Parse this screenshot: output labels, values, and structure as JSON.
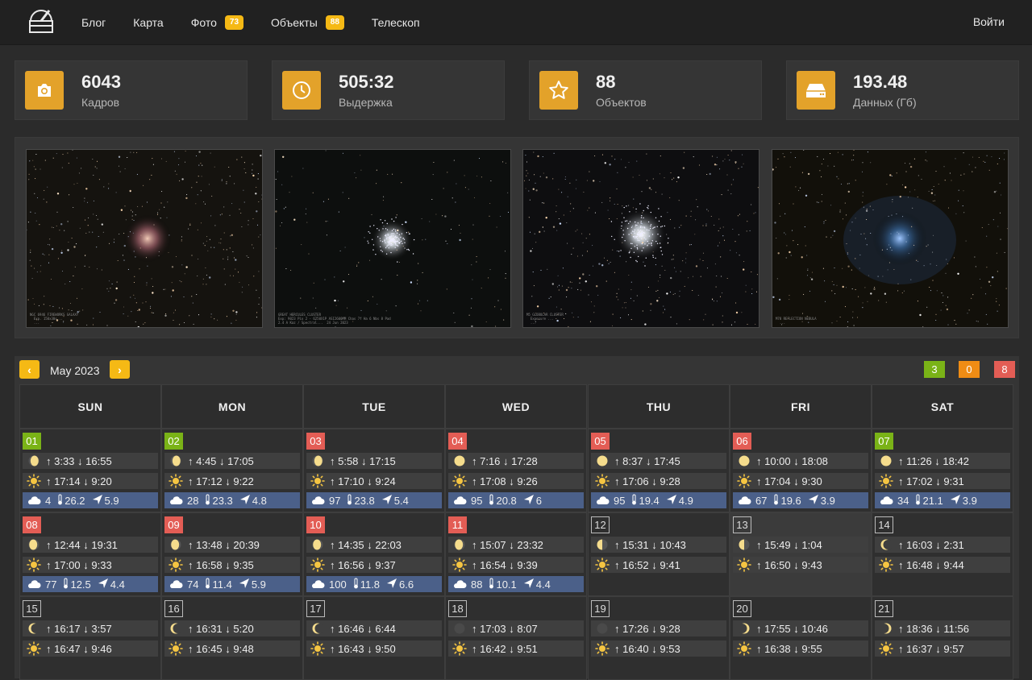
{
  "nav": {
    "links": [
      {
        "label": "Блог"
      },
      {
        "label": "Карта"
      },
      {
        "label": "Фото",
        "badge": "73"
      },
      {
        "label": "Объекты",
        "badge": "88"
      },
      {
        "label": "Телескоп"
      }
    ],
    "login": "Войти"
  },
  "stats": [
    {
      "value": "6043",
      "label": "Кадров",
      "icon": "camera-icon"
    },
    {
      "value": "505:32",
      "label": "Выдержка",
      "icon": "clock-icon"
    },
    {
      "value": "88",
      "label": "Объектов",
      "icon": "star-icon"
    },
    {
      "value": "193.48",
      "label": "Данных (Гб)",
      "icon": "drive-icon"
    }
  ],
  "photos": [
    {
      "name": "photo-galaxy",
      "caption": "NGC 6946 FIREWORKS GALAXY\n  Exp. 150x30s...\n  ...",
      "feature": "galaxy"
    },
    {
      "name": "photo-hercules-cluster",
      "caption": "GREAT HERCULES CLUSTER\nExp: 9023 Pix 2 - 6250X1P ASI2600MM Chas 7f Ha 6 Nbs 8 Pad\n2.4 A Kaz / Spectral...  24 Jun 2023",
      "feature": "cluster"
    },
    {
      "name": "photo-globular-cluster",
      "caption": "M5 GLOBULAR CLUSTER\n  Exposure ...\n  ...",
      "feature": "cluster"
    },
    {
      "name": "photo-nebula",
      "caption": "M78 REFLECTION NEBULA\n  ...",
      "feature": "nebula"
    }
  ],
  "calendar": {
    "month": "May 2023",
    "prev": "‹",
    "next": "›",
    "counts": [
      {
        "value": "3",
        "color": "#7ab317"
      },
      {
        "value": "0",
        "color": "#ef8c14"
      },
      {
        "value": "8",
        "color": "#e35d55"
      }
    ],
    "weekdays": [
      "SUN",
      "MON",
      "TUE",
      "WED",
      "THU",
      "FRI",
      "SAT"
    ],
    "days": [
      {
        "d": "01",
        "s": "g",
        "moon": "↑ 3:33 ↓ 16:55",
        "sun": "↑ 17:14 ↓ 9:20",
        "phase": "wax-gib",
        "wx": [
          "4",
          "26.2",
          "5.9"
        ]
      },
      {
        "d": "02",
        "s": "g",
        "moon": "↑ 4:45 ↓ 17:05",
        "sun": "↑ 17:12 ↓ 9:22",
        "phase": "wax-gib",
        "wx": [
          "28",
          "23.3",
          "4.8"
        ]
      },
      {
        "d": "03",
        "s": "r",
        "moon": "↑ 5:58 ↓ 17:15",
        "sun": "↑ 17:10 ↓ 9:24",
        "phase": "wax-gib",
        "wx": [
          "97",
          "23.8",
          "5.4"
        ]
      },
      {
        "d": "04",
        "s": "r",
        "moon": "↑ 7:16 ↓ 17:28",
        "sun": "↑ 17:08 ↓ 9:26",
        "phase": "full",
        "wx": [
          "95",
          "20.8",
          "6"
        ]
      },
      {
        "d": "05",
        "s": "r",
        "moon": "↑ 8:37 ↓ 17:45",
        "sun": "↑ 17:06 ↓ 9:28",
        "phase": "full",
        "wx": [
          "95",
          "19.4",
          "4.9"
        ]
      },
      {
        "d": "06",
        "s": "r",
        "moon": "↑ 10:00 ↓ 18:08",
        "sun": "↑ 17:04 ↓ 9:30",
        "phase": "full",
        "wx": [
          "67",
          "19.6",
          "3.9"
        ]
      },
      {
        "d": "07",
        "s": "g",
        "moon": "↑ 11:26 ↓ 18:42",
        "sun": "↑ 17:02 ↓ 9:31",
        "phase": "full",
        "wx": [
          "34",
          "21.1",
          "3.9"
        ]
      },
      {
        "d": "08",
        "s": "r",
        "moon": "↑ 12:44 ↓ 19:31",
        "sun": "↑ 17:00 ↓ 9:33",
        "phase": "wan-gib",
        "wx": [
          "77",
          "12.5",
          "4.4"
        ]
      },
      {
        "d": "09",
        "s": "r",
        "moon": "↑ 13:48 ↓ 20:39",
        "sun": "↑ 16:58 ↓ 9:35",
        "phase": "wan-gib",
        "wx": [
          "74",
          "11.4",
          "5.9"
        ]
      },
      {
        "d": "10",
        "s": "r",
        "moon": "↑ 14:35 ↓ 22:03",
        "sun": "↑ 16:56 ↓ 9:37",
        "phase": "wan-gib",
        "wx": [
          "100",
          "11.8",
          "6.6"
        ]
      },
      {
        "d": "11",
        "s": "r",
        "moon": "↑ 15:07 ↓ 23:32",
        "sun": "↑ 16:54 ↓ 9:39",
        "phase": "wan-gib",
        "wx": [
          "88",
          "10.1",
          "4.4"
        ]
      },
      {
        "d": "12",
        "s": "n",
        "moon": "↑ 15:31 ↓ 10:43",
        "sun": "↑ 16:52 ↓ 9:41",
        "phase": "last-q"
      },
      {
        "d": "13",
        "s": "n",
        "today": true,
        "moon": "↑ 15:49 ↓ 1:04",
        "sun": "↑ 16:50 ↓ 9:43",
        "phase": "last-q"
      },
      {
        "d": "14",
        "s": "n",
        "moon": "↑ 16:03 ↓ 2:31",
        "sun": "↑ 16:48 ↓ 9:44",
        "phase": "wan-cres"
      },
      {
        "d": "15",
        "s": "n",
        "moon": "↑ 16:17 ↓ 3:57",
        "sun": "↑ 16:47 ↓ 9:46",
        "phase": "wan-cres"
      },
      {
        "d": "16",
        "s": "n",
        "moon": "↑ 16:31 ↓ 5:20",
        "sun": "↑ 16:45 ↓ 9:48",
        "phase": "wan-cres"
      },
      {
        "d": "17",
        "s": "n",
        "moon": "↑ 16:46 ↓ 6:44",
        "sun": "↑ 16:43 ↓ 9:50",
        "phase": "wan-cres"
      },
      {
        "d": "18",
        "s": "n",
        "moon": "↑ 17:03 ↓ 8:07",
        "sun": "↑ 16:42 ↓ 9:51",
        "phase": "new"
      },
      {
        "d": "19",
        "s": "n",
        "moon": "↑ 17:26 ↓ 9:28",
        "sun": "↑ 16:40 ↓ 9:53",
        "phase": "new"
      },
      {
        "d": "20",
        "s": "n",
        "moon": "↑ 17:55 ↓ 10:46",
        "sun": "↑ 16:38 ↓ 9:55",
        "phase": "wax-cres"
      },
      {
        "d": "21",
        "s": "n",
        "moon": "↑ 18:36 ↓ 11:56",
        "sun": "↑ 16:37 ↓ 9:57",
        "phase": "wax-cres"
      }
    ]
  },
  "colors": {
    "accent": "#f5b915",
    "good": "#7ab317",
    "bad": "#e35d55",
    "weather": "#4b6089"
  }
}
